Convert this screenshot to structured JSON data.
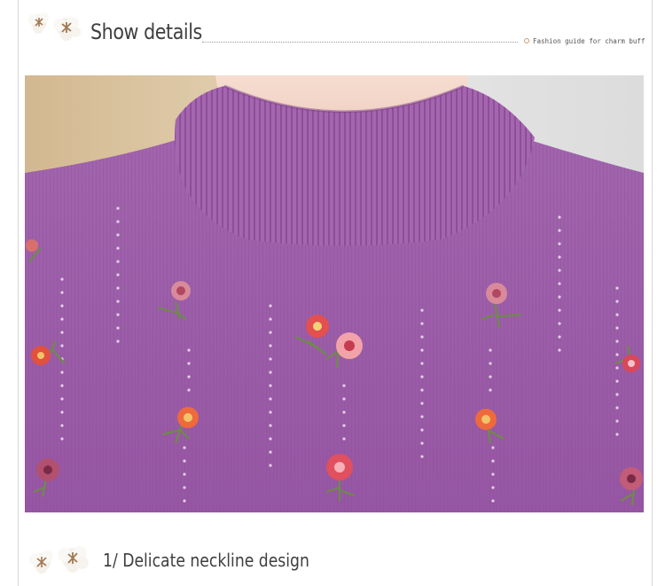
{
  "header": {
    "title": "Show details",
    "guide_text": "Fashion guide for charm buff"
  },
  "photo": {
    "subject": "purple knit sweater with embroidered flowers",
    "colors": {
      "sweater": "#9a5aa6",
      "background_left": "#cdb48f",
      "background_right": "#e8e8e8"
    }
  },
  "section": {
    "label": "1/ Delicate neckline design"
  },
  "icons": [
    "cotton-flower-icon"
  ]
}
